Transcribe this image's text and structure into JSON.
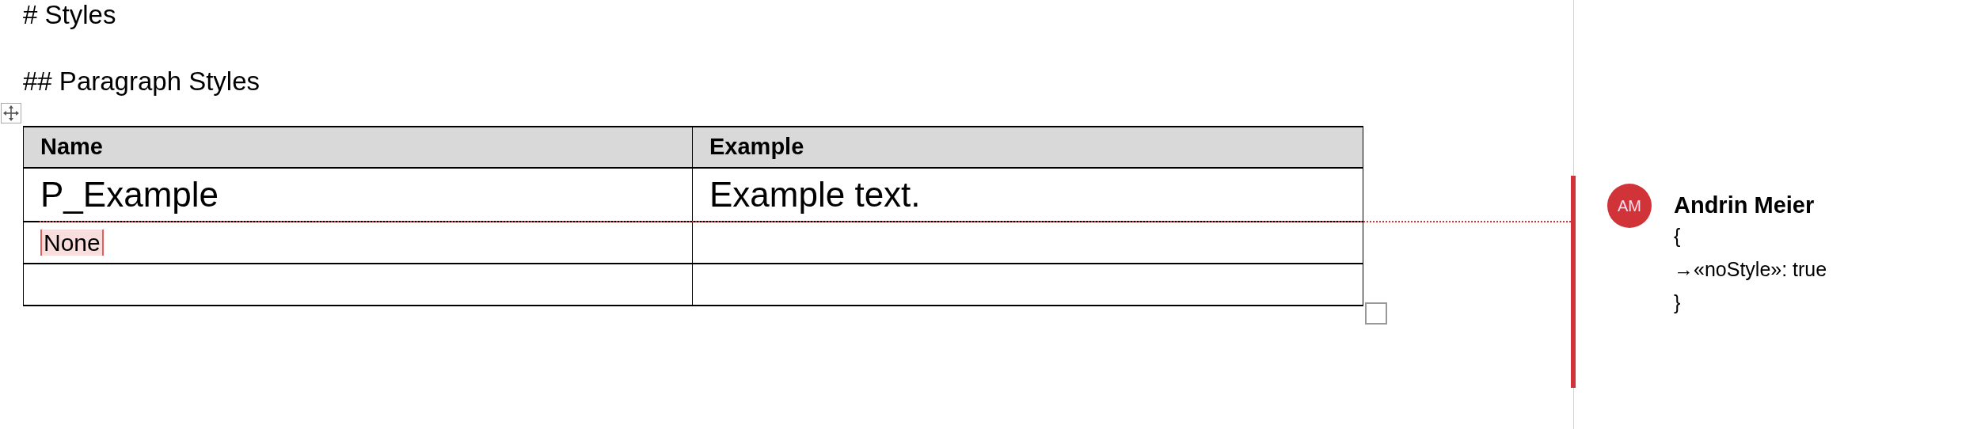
{
  "document": {
    "headings": [
      {
        "kind": "h1",
        "text": "# Styles"
      },
      {
        "kind": "h2",
        "text": "## Paragraph Styles"
      }
    ],
    "table": {
      "columns": [
        "Name",
        "Example"
      ],
      "rows": [
        {
          "kind": "styled",
          "name": "P_Example",
          "example": "Example text.",
          "commented": false
        },
        {
          "kind": "plain",
          "name": "None",
          "commented": true
        },
        {
          "kind": "plain",
          "commented": false
        }
      ]
    }
  },
  "comment": {
    "initials": "AM",
    "author": "Andrin Meier",
    "lines": [
      "{",
      "→«noStyle»: true",
      "}"
    ]
  }
}
